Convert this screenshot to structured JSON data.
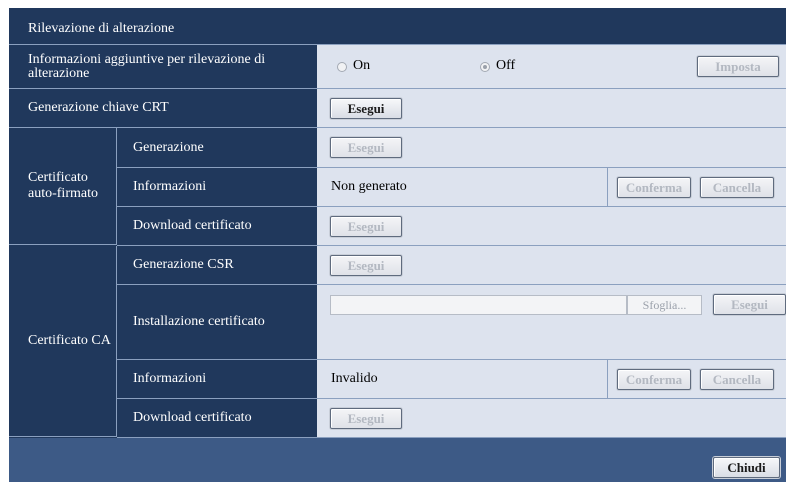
{
  "title": "Rilevazione di alterazione",
  "rows": {
    "tamper_info": {
      "label": "Informazioni aggiuntive per rilevazione di alterazione",
      "option_on": "On",
      "option_off": "Off",
      "selected": "Off",
      "set_button": "Imposta"
    },
    "crt_key": {
      "label": "Generazione chiave CRT",
      "button": "Esegui"
    }
  },
  "self_signed": {
    "group_label": "Certificato auto-firmato",
    "generation": {
      "label": "Generazione",
      "button": "Esegui"
    },
    "info": {
      "label": "Informazioni",
      "value": "Non generato",
      "confirm_button": "Conferma",
      "delete_button": "Cancella"
    },
    "download": {
      "label": "Download certificato",
      "button": "Esegui"
    }
  },
  "ca_cert": {
    "group_label": "Certificato CA",
    "csr": {
      "label": "Generazione CSR",
      "button": "Esegui"
    },
    "install": {
      "label": "Installazione certificato",
      "file_value": "",
      "browse_button": "Sfoglia...",
      "button": "Esegui"
    },
    "info": {
      "label": "Informazioni",
      "value": "Invalido",
      "confirm_button": "Conferma",
      "delete_button": "Cancella"
    },
    "download": {
      "label": "Download certificato",
      "button": "Esegui"
    }
  },
  "footer": {
    "close_button": "Chiudi"
  }
}
